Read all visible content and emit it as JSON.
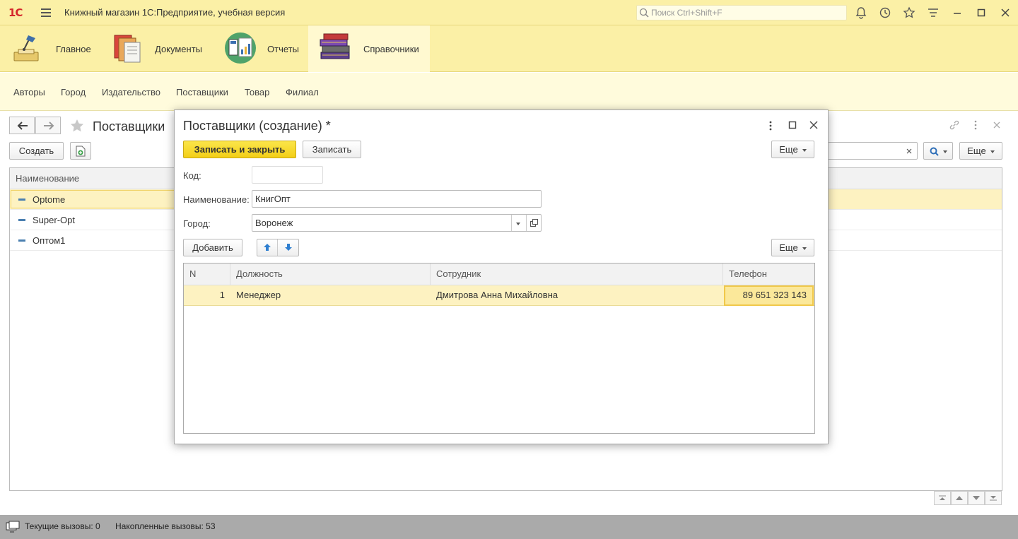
{
  "app": {
    "logo": "1С",
    "title": "Книжный магазин 1С:Предприятие, учебная версия",
    "search_placeholder": "Поиск Ctrl+Shift+F"
  },
  "sections": [
    {
      "label": "Главное",
      "icon": "desk-lamp-icon"
    },
    {
      "label": "Документы",
      "icon": "documents-icon"
    },
    {
      "label": "Отчеты",
      "icon": "reports-icon"
    },
    {
      "label": "Справочники",
      "icon": "books-icon",
      "active": true
    }
  ],
  "nav_links": [
    "Авторы",
    "Город",
    "Издательство",
    "Поставщики",
    "Товар",
    "Филиал"
  ],
  "list_form": {
    "title": "Поставщики",
    "create_label": "Создать",
    "more_label": "Еще",
    "column": "Наименование",
    "rows": [
      "Optome",
      "Super-Opt",
      "Оптом1"
    ],
    "selected_row": 0
  },
  "modal": {
    "title": "Поставщики (создание) *",
    "save_close_label": "Записать и закрыть",
    "save_label": "Записать",
    "more_label": "Еще",
    "code_label": "Код:",
    "code_value": "",
    "name_label": "Наименование:",
    "name_value": "КнигОпт",
    "city_label": "Город:",
    "city_value": "Воронеж",
    "add_label": "Добавить",
    "table_more_label": "Еще",
    "columns": [
      "N",
      "Должность",
      "Сотрудник",
      "Телефон"
    ],
    "rows": [
      {
        "n": "1",
        "position": "Менеджер",
        "employee": "Дмитрова Анна Михайловна",
        "phone": "89 651 323 143"
      }
    ]
  },
  "status": {
    "current_calls": "Текущие вызовы: 0",
    "accumulated_calls": "Накопленные вызовы: 53"
  },
  "colors": {
    "header_bg": "#fbf0a6",
    "accent_button": "#f3cf17",
    "selected_row": "#fdf2c1"
  }
}
